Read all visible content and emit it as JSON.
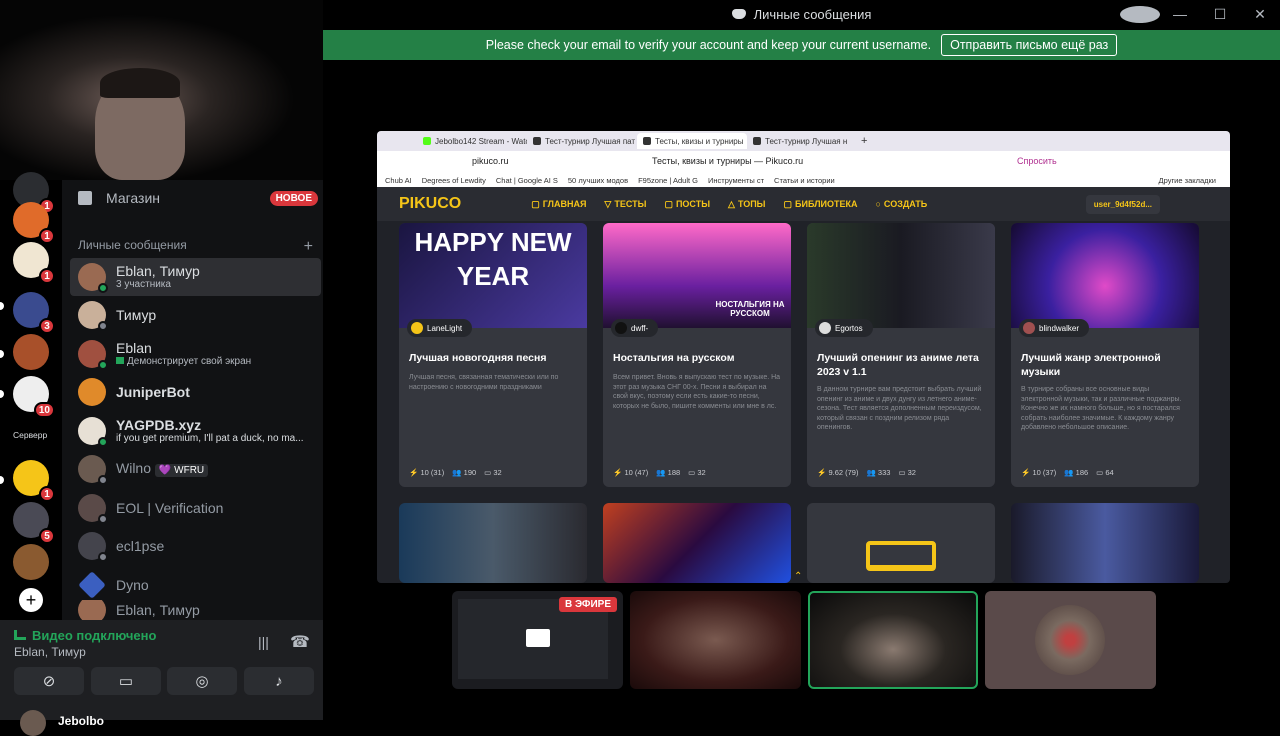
{
  "window": {
    "title": "Личные сообщения"
  },
  "notice": {
    "text": "Please check your email to verify your account and keep your current username.",
    "button": "Отправить письмо ещё раз"
  },
  "rail": {
    "badges": [
      "1",
      "1",
      "3",
      "10",
      "1",
      "5"
    ],
    "server_label": "Серверр"
  },
  "dm": {
    "shop_label": "Магазин",
    "shop_badge": "НОВОЕ",
    "section_label": "Личные сообщения",
    "items": [
      {
        "name": "Eblan, Тимур",
        "sub": "3 участника"
      },
      {
        "name": "Тимур",
        "sub": ""
      },
      {
        "name": "Eblan",
        "sub": "Демонстрирует свой экран"
      },
      {
        "name": "JuniperBot",
        "sub": ""
      },
      {
        "name": "YAGPDB.xyz",
        "sub": "if you get premium, I'll pat a duck, no ma..."
      },
      {
        "name": "Wilno",
        "sub": ""
      },
      {
        "name": "EOL | Verification",
        "sub": ""
      },
      {
        "name": "ecl1pse",
        "sub": ""
      },
      {
        "name": "Dyno",
        "sub": ""
      },
      {
        "name": "Eblan, Тимур",
        "sub": ""
      }
    ],
    "wilno_tag": "WFRU"
  },
  "voice": {
    "status": "Видео подключено",
    "channel": "Eblan, Тимур",
    "user": "Jebolbo"
  },
  "browser": {
    "tabs": [
      "Jebolbo142 Stream - Watc",
      "Тест-турнир Лучшая пат",
      "Тесты, квизы и турниры",
      "Тест-турнир Лучшая н"
    ],
    "url": "pikuco.ru",
    "page_title": "Тесты, квизы и турниры — Pikuco.ru",
    "ask": "Спросить",
    "bookmarks": [
      "Chub AI",
      "Degrees of Lewdity",
      "Chat | Google AI S",
      "50 лучших модов",
      "F95zone | Adult G",
      "Инструменты ст",
      "Статьи и истории"
    ],
    "other_bookmarks": "Другие закладки",
    "site": {
      "logo": "PIKUCO",
      "nav": [
        "ГЛАВНАЯ",
        "ТЕСТЫ",
        "ПОСТЫ",
        "ТОПЫ",
        "БИБЛИОТЕКА",
        "СОЗДАТЬ"
      ],
      "user": "user_9d4f52d...",
      "cards": [
        {
          "author": "LaneLight",
          "title": "Лучшая новогодняя песня",
          "desc": "Лучшая песня, связанная тематически или по настроению с новогодними праздниками",
          "s1": "10",
          "s1b": "31",
          "s2": "190",
          "s3": "32",
          "banner": "HAPPY NEW YEAR"
        },
        {
          "author": "dwff-",
          "title": "Ностальгия на русском",
          "desc": "Всем привет. Вновь я выпускаю тест по музыке. На этот раз музыка СНГ 00-х. Песни я выбирал на свой вкус, поэтому если есть какие-то песни, которых не было, пишите комменты или мне в лс.",
          "s1": "10",
          "s1b": "47",
          "s2": "188",
          "s3": "32",
          "banner": "НОСТАЛЬГИЯ НА РУССКОМ"
        },
        {
          "author": "Egortos",
          "title": "Лучший опенинг из аниме лета 2023 v 1.1",
          "desc": "В данном турнире вам предстоит выбрать лучший опенинг из аниме и двух дунгу из летнего аниме-сезона. Тест является дополненным переиздусом, который связан с поздним релизом ряда опенингов.",
          "s1": "9.62",
          "s1b": "79",
          "s2": "333",
          "s3": "32",
          "banner": ""
        },
        {
          "author": "blindwalker",
          "title": "Лучший жанр электронной музыки",
          "desc": "В турнире собраны все основные виды электронной музыки, так и различные поджанры. Конечно же их намного больше, но я постарался собрать наиболее значимые. К каждому жанру добавлено небольшое описание.",
          "s1": "10",
          "s1b": "37",
          "s2": "186",
          "s3": "64",
          "banner": ""
        }
      ]
    }
  },
  "tiles": {
    "live": "В ЭФИРЕ"
  },
  "colors": {
    "accent_green": "#248046",
    "badge_red": "#da373c",
    "pikuco_yellow": "#f5c518"
  }
}
